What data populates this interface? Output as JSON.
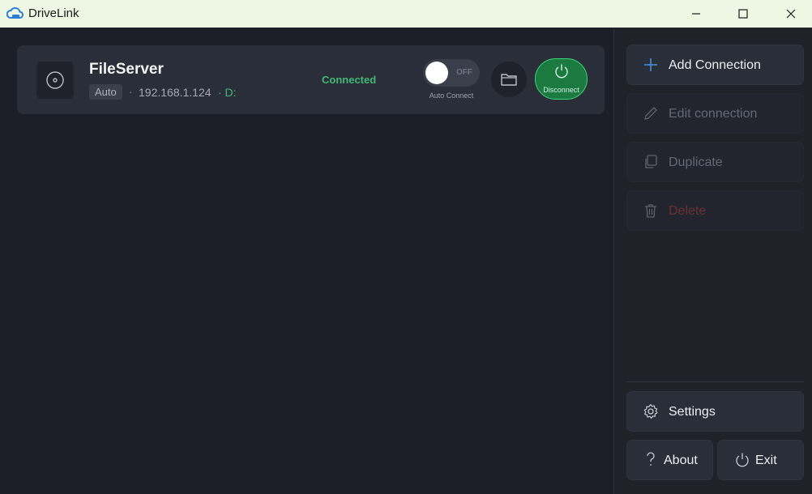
{
  "window": {
    "title": "DriveLink",
    "controls": {
      "minimize": "minimize",
      "maximize": "maximize",
      "close": "close"
    }
  },
  "connections": [
    {
      "name": "FileServer",
      "tag": "Auto",
      "separator": "·",
      "ip": "192.168.1.124",
      "drive": "· D:",
      "status": "Connected",
      "auto_connect": {
        "state": "OFF",
        "caption": "Auto Connect",
        "enabled": false
      },
      "disconnect_label": "Disconnect"
    }
  ],
  "sidebar": {
    "add_connection": "Add Connection",
    "edit_connection": "Edit connection",
    "duplicate": "Duplicate",
    "delete": "Delete",
    "settings": "Settings",
    "about": "About",
    "exit": "Exit"
  },
  "colors": {
    "accent_green": "#41b876",
    "disconnect_bg": "#1b7a3f",
    "titlebar_bg": "#eef6e4",
    "background": "#1c1f27",
    "card_bg": "#2a2e38"
  }
}
